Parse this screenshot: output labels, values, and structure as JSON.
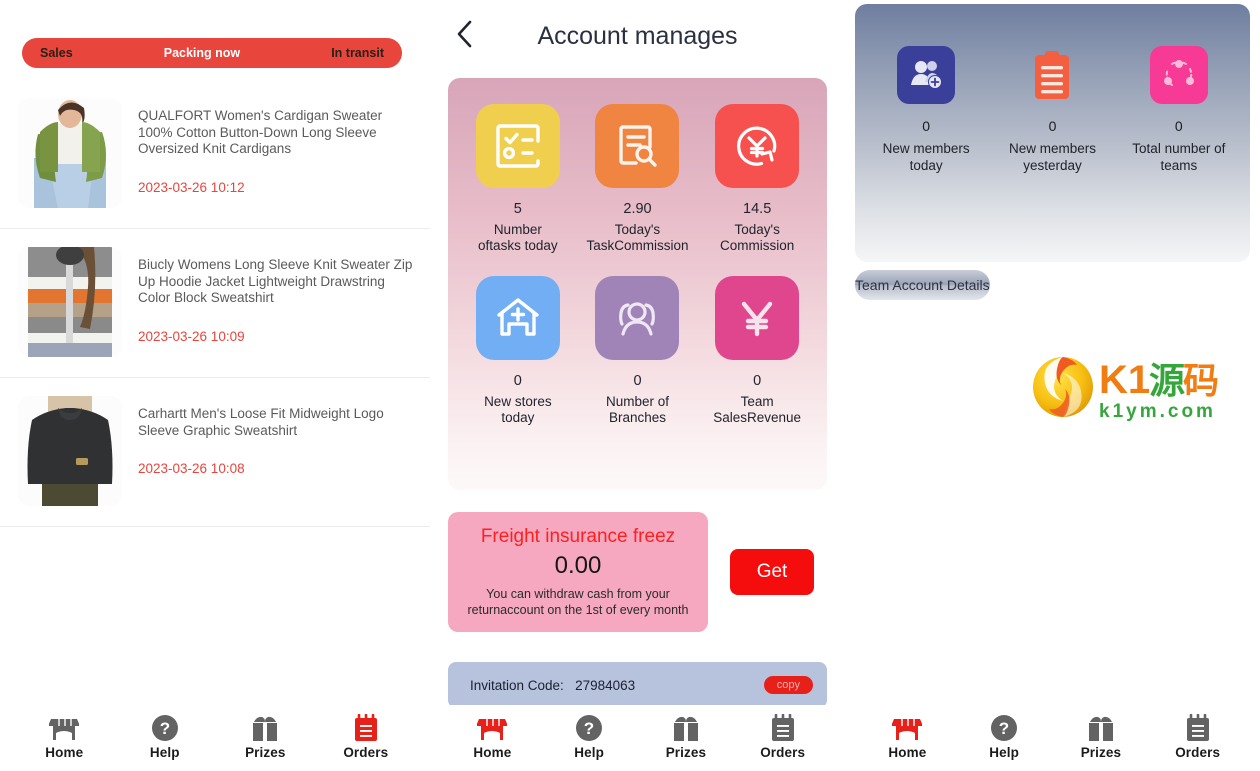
{
  "left_panel": {
    "tabs": [
      {
        "label": "Sales",
        "active": false
      },
      {
        "label": "Packing now",
        "active": true
      },
      {
        "label": "In transit",
        "active": false
      }
    ],
    "orders": [
      {
        "title": "QUALFORT Women's Cardigan Sweater 100% Cotton Button-Down Long Sleeve Oversized Knit Cardigans",
        "date": "2023-03-26 10:12",
        "thumb": "green-cardigan-photo"
      },
      {
        "title": "Biucly Womens Long Sleeve Knit Sweater Zip Up Hoodie Jacket Lightweight Drawstring Color Block Sweatshirt",
        "date": "2023-03-26 10:09",
        "thumb": "striped-hoodie-photo"
      },
      {
        "title": "Carhartt Men's Loose Fit Midweight Logo Sleeve Graphic Sweatshirt",
        "date": "2023-03-26 10:08",
        "thumb": "black-sweatshirt-photo"
      }
    ],
    "nav": [
      {
        "label": "Home",
        "icon": "store-icon",
        "active": false
      },
      {
        "label": "Help",
        "icon": "question-circle-icon",
        "active": false
      },
      {
        "label": "Prizes",
        "icon": "gift-icon",
        "active": false
      },
      {
        "label": "Orders",
        "icon": "clipboard-icon",
        "active": true
      }
    ]
  },
  "mid_panel": {
    "header": {
      "title": "Account manages",
      "back_icon": "chevron-left-icon"
    },
    "stats": [
      {
        "value": "5",
        "label_line1": "Number",
        "label_line2": "oftasks today",
        "icon": "checklist-icon",
        "color": "#f0cf4e"
      },
      {
        "value": "2.90",
        "label_line1": "Today's",
        "label_line2": "TaskCommission",
        "icon": "document-search-icon",
        "color": "#ef8540"
      },
      {
        "value": "14.5",
        "label_line1": "Today's",
        "label_line2": "Commission",
        "icon": "yuan-refresh-icon",
        "color": "#f6514f"
      },
      {
        "value": "0",
        "label_line1": "New stores",
        "label_line2": "today",
        "icon": "add-store-icon",
        "color": "#72aef4"
      },
      {
        "value": "0",
        "label_line1": "Number of",
        "label_line2": "Branches",
        "icon": "group-people-icon",
        "color": "#a084b8"
      },
      {
        "value": "0",
        "label_line1": "Team",
        "label_line2": "SalesRevenue",
        "icon": "yuan-icon",
        "color": "#e0468e"
      }
    ],
    "freight": {
      "title": "Freight insurance freez",
      "amount": "0.00",
      "note": "You can withdraw cash from your returnaccount on the 1st of every month",
      "button_label": "Get"
    },
    "invitation": {
      "label": "Invitation Code:",
      "code": "27984063",
      "copy_label": "copy"
    },
    "nav": [
      {
        "label": "Home",
        "icon": "store-icon",
        "active": true
      },
      {
        "label": "Help",
        "icon": "question-circle-icon",
        "active": false
      },
      {
        "label": "Prizes",
        "icon": "gift-icon",
        "active": false
      },
      {
        "label": "Orders",
        "icon": "clipboard-icon",
        "active": false
      }
    ]
  },
  "right_panel": {
    "team_stats": [
      {
        "value": "0",
        "label_line1": "New members",
        "label_line2": "today",
        "icon": "add-member-icon",
        "color": "#3a3f99"
      },
      {
        "value": "0",
        "label_line1": "New members",
        "label_line2": "yesterday",
        "icon": "clipboard-list-icon",
        "color": "#f4603f"
      },
      {
        "value": "0",
        "label_line1": "Total number of",
        "label_line2": "teams",
        "icon": "team-network-icon",
        "color": "#f63a96"
      }
    ],
    "team_details_label": "Team Account Details",
    "watermark": {
      "brand": "K1",
      "brand_cn": "源码",
      "domain": "k1ym.com"
    },
    "nav": [
      {
        "label": "Home",
        "icon": "store-icon",
        "active": true
      },
      {
        "label": "Help",
        "icon": "question-circle-icon",
        "active": false
      },
      {
        "label": "Prizes",
        "icon": "gift-icon",
        "active": false
      },
      {
        "label": "Orders",
        "icon": "clipboard-icon",
        "active": false
      }
    ]
  },
  "colors": {
    "accent_red": "#e8453c",
    "get_button_red": "#f50d0d",
    "freight_pink": "#f5a8bf",
    "invite_blue": "#b7c3dd",
    "nav_inactive": "#636363"
  }
}
